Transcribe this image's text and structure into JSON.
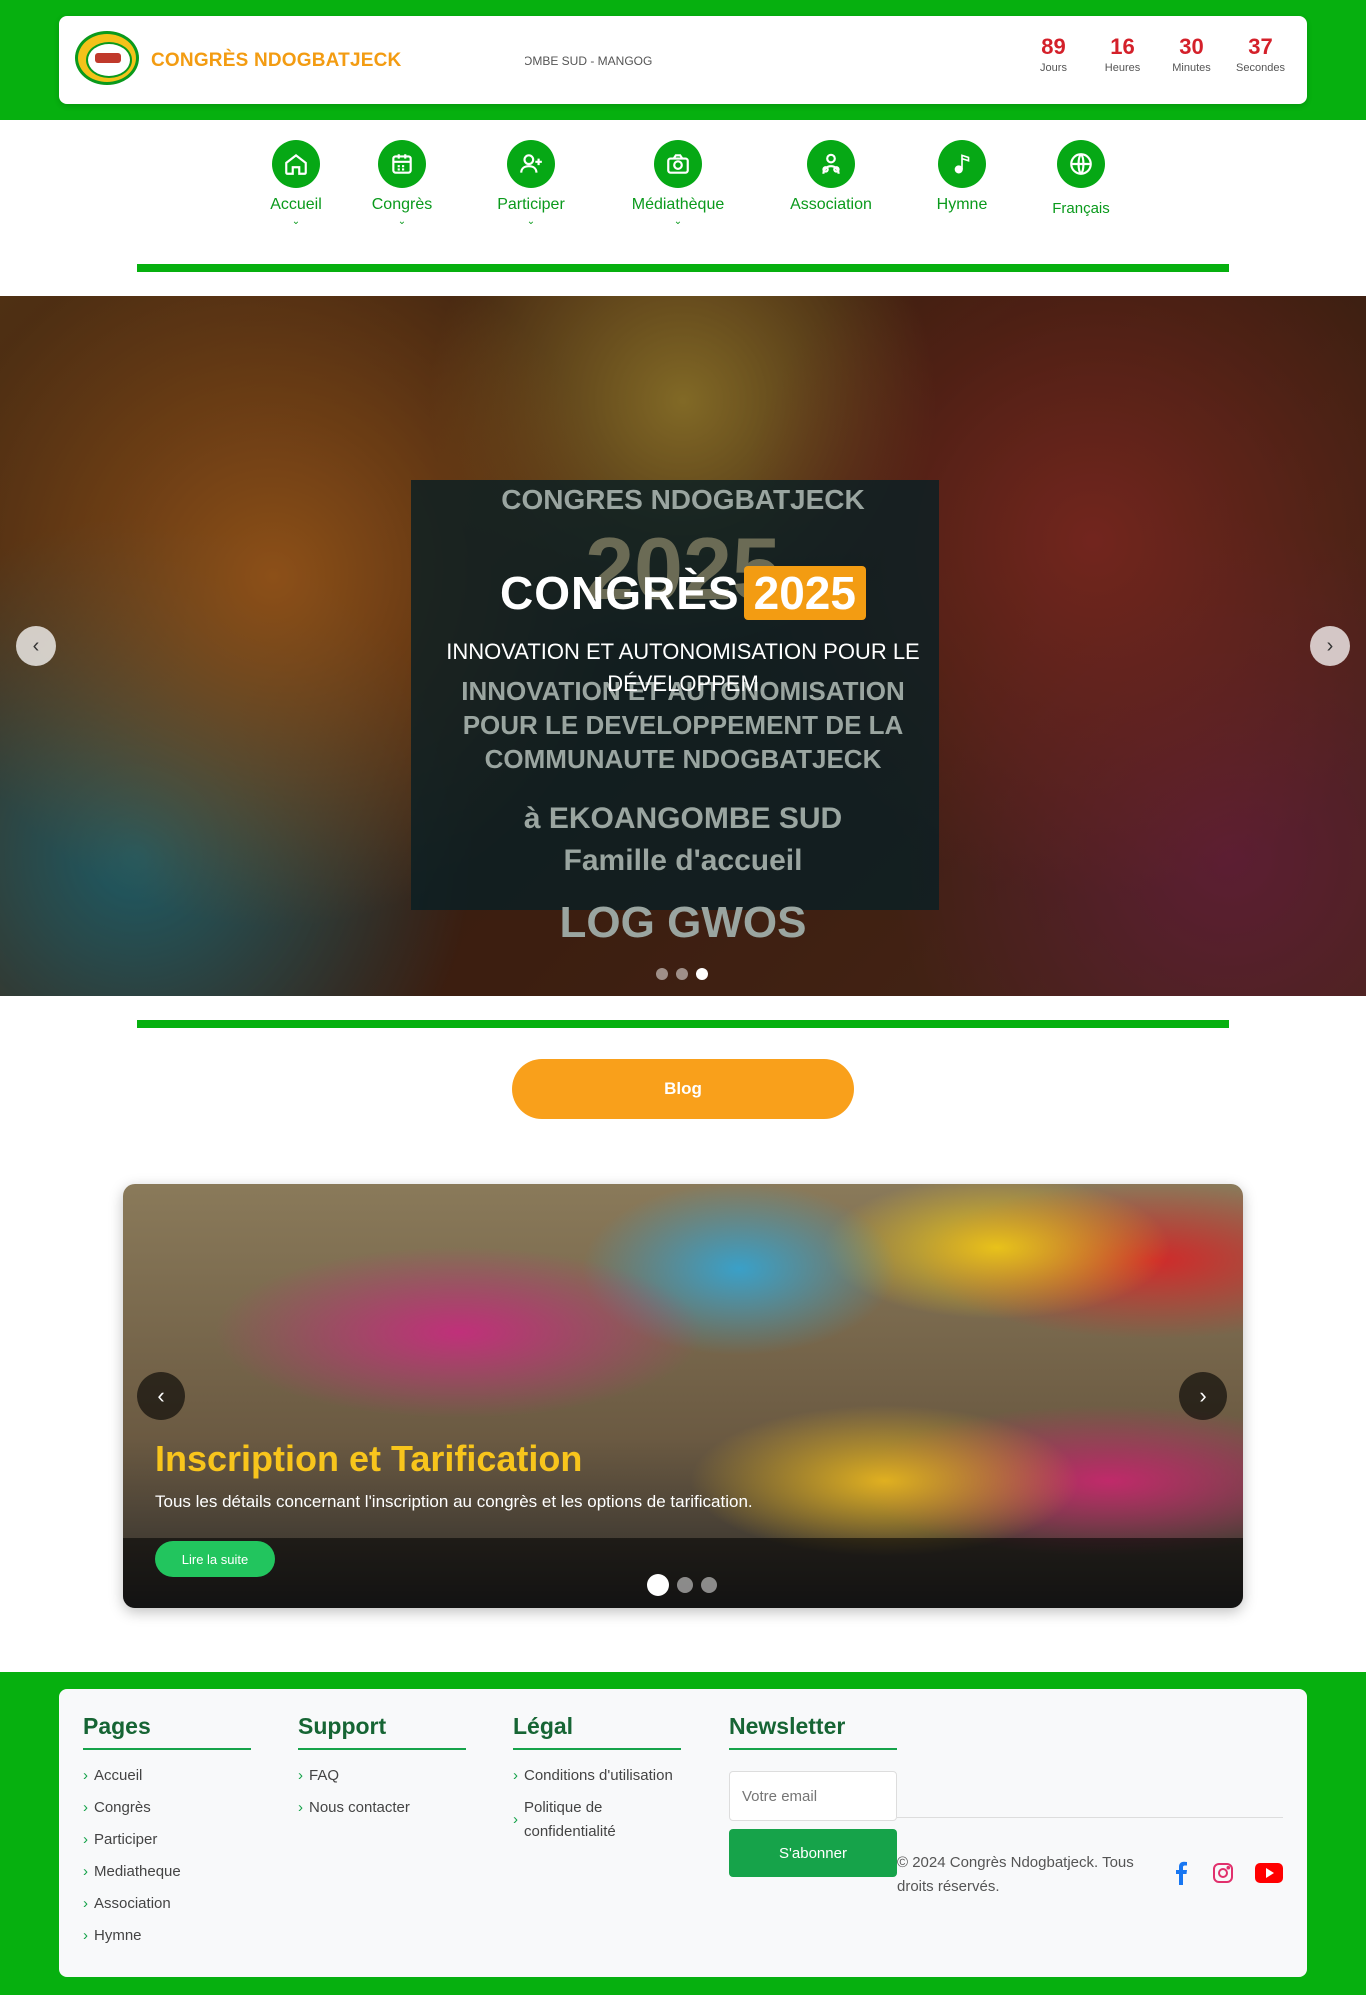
{
  "header": {
    "brand": "CONGRÈS NDOGBATJECK",
    "ticker": "OMBE SUD - MANGOG",
    "countdown": [
      {
        "value": "89",
        "label": "Jours"
      },
      {
        "value": "16",
        "label": "Heures"
      },
      {
        "value": "30",
        "label": "Minutes"
      },
      {
        "value": "37",
        "label": "Secondes"
      }
    ]
  },
  "nav": {
    "items": [
      {
        "label": "Accueil",
        "icon": "home-icon",
        "has_dropdown": true
      },
      {
        "label": "Congrès",
        "icon": "calendar-icon",
        "has_dropdown": true
      },
      {
        "label": "Participer",
        "icon": "user-plus-icon",
        "has_dropdown": true
      },
      {
        "label": "Médiathèque",
        "icon": "camera-icon",
        "has_dropdown": true
      },
      {
        "label": "Association",
        "icon": "users-icon",
        "has_dropdown": false
      },
      {
        "label": "Hymne",
        "icon": "music-icon",
        "has_dropdown": false
      },
      {
        "label": "Français",
        "icon": "globe-icon",
        "has_dropdown": false
      }
    ]
  },
  "hero": {
    "title_word": "CONGRÈS",
    "title_year": "2025",
    "subtitle": "INNOVATION ET AUTONOMISATION POUR LE DÉVELOPPEM",
    "poster_lines": [
      "CONGRES NDOGBATJECK",
      "2025",
      "INNOVATION ET AUTONOMISATION",
      "POUR LE DEVELOPPEMENT DE LA",
      "COMMUNAUTE NDOGBATJECK",
      "à EKOANGOMBE SUD",
      "Famille d'accueil",
      "LOG GWOS"
    ],
    "slides": 3,
    "active_slide": 3
  },
  "blog": {
    "label": "Blog"
  },
  "slider": {
    "title": "Inscription et Tarification",
    "description": "Tous les détails concernant l'inscription au congrès et les options de tarification.",
    "button": "Lire la suite",
    "slides": 3,
    "active_slide": 1
  },
  "footer": {
    "pages": {
      "title": "Pages",
      "links": [
        "Accueil",
        "Congrès",
        "Participer",
        "Mediatheque",
        "Association",
        "Hymne"
      ]
    },
    "support": {
      "title": "Support",
      "links": [
        "FAQ",
        "Nous contacter"
      ]
    },
    "legal": {
      "title": "Légal",
      "links": [
        "Conditions d'utilisation",
        "Politique de confidentialité"
      ]
    },
    "newsletter": {
      "title": "Newsletter",
      "placeholder": "Votre email",
      "button": "S'abonner"
    },
    "copyright": "© 2024 Congrès Ndogbatjeck. Tous droits réservés.",
    "social": [
      {
        "icon": "facebook-icon",
        "color": "#1877f2"
      },
      {
        "icon": "instagram-icon",
        "color": "#e1306c"
      },
      {
        "icon": "youtube-icon",
        "color": "#ff0000"
      }
    ]
  },
  "colors": {
    "primary_green": "#06b00f",
    "accent_orange": "#f39c12",
    "countdown_red": "#d4202a"
  }
}
